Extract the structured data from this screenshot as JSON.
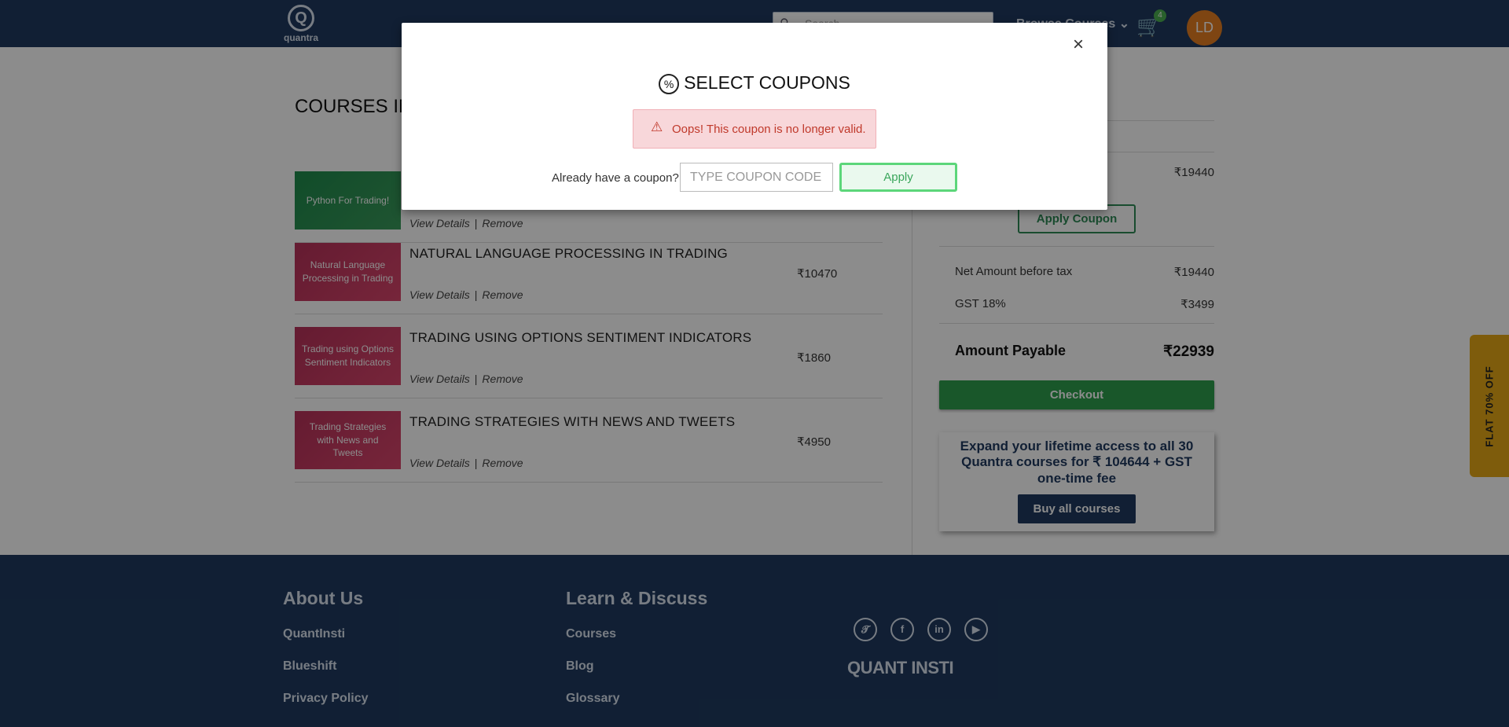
{
  "header": {
    "logo_text": "quantra",
    "search_placeholder": "Search",
    "browse_label": "Browse Courses",
    "cart_count": "4",
    "avatar_initials": "LD"
  },
  "cart": {
    "section_title": "COURSES IN CART",
    "courses": [
      {
        "thumb": "Python For Trading!",
        "title": "",
        "price": "",
        "view": "View Details",
        "remove": "Remove"
      },
      {
        "thumb": "Natural Language Processing in Trading",
        "title": "NATURAL LANGUAGE PROCESSING IN TRADING",
        "price": "₹10470",
        "view": "View Details",
        "remove": "Remove"
      },
      {
        "thumb": "Trading using Options Sentiment Indicators",
        "title": "TRADING USING OPTIONS SENTIMENT INDICATORS",
        "price": "₹1860",
        "view": "View Details",
        "remove": "Remove"
      },
      {
        "thumb": "Trading Strategies with News and Tweets",
        "title": "TRADING STRATEGIES WITH NEWS AND TWEETS",
        "price": "₹4950",
        "view": "View Details",
        "remove": "Remove"
      }
    ]
  },
  "summary": {
    "subtotal_value": "₹19440",
    "apply_coupon_label": "Apply Coupon",
    "net_label": "Net Amount before tax",
    "net_value": "₹19440",
    "gst_label": "GST 18%",
    "gst_value": "₹3499",
    "payable_label": "Amount Payable",
    "payable_value": "₹22939",
    "checkout_label": "Checkout",
    "promo_text": "Expand your lifetime access to all 30 Quantra courses for ₹ 104644 + GST one-time fee",
    "buy_all_label": "Buy all courses"
  },
  "side_tab": "FLAT 70% OFF",
  "footer": {
    "about_head": "About Us",
    "about_links": [
      "QuantInsti",
      "Blueshift",
      "Privacy Policy"
    ],
    "learn_head": "Learn & Discuss",
    "learn_links": [
      "Courses",
      "Blog",
      "Glossary"
    ],
    "social_icons": [
      "twitter-icon",
      "facebook-icon",
      "linkedin-icon",
      "youtube-icon"
    ],
    "brand_logo": "QUANT INSTI"
  },
  "modal": {
    "title": "SELECT COUPONS",
    "alert_text": "Oops! This coupon is no longer valid.",
    "coupon_label": "Already have a coupon?",
    "coupon_placeholder": "TYPE COUPON CODE",
    "coupon_value": "",
    "apply_label": "Apply",
    "close_symbol": "×"
  },
  "colors": {
    "header_bg": "#1f3a5f",
    "checkout_green": "#2f9e4e",
    "alert_bg": "#f8d7da",
    "alert_text": "#c0392b",
    "side_tab_bg": "#e6a817"
  }
}
